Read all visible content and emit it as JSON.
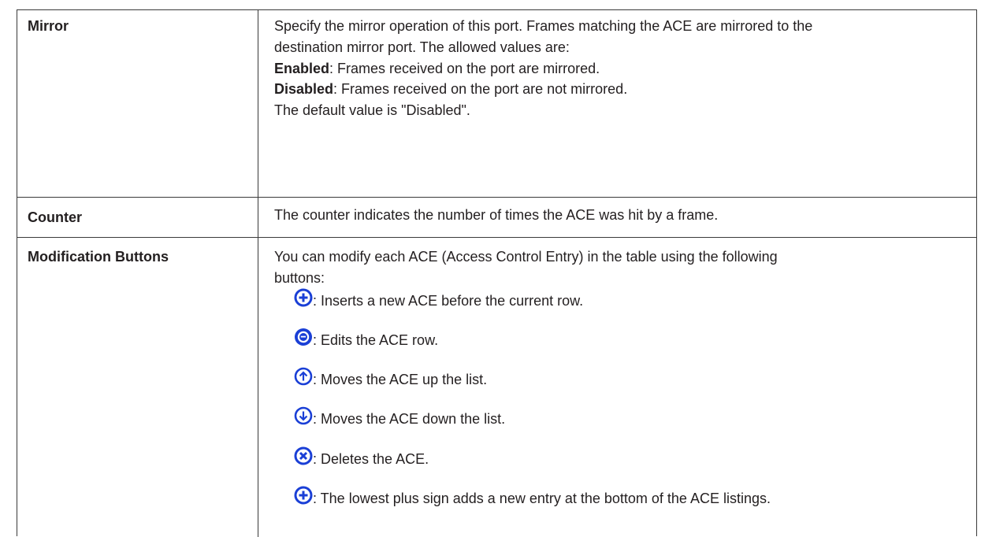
{
  "rows": {
    "mirror": {
      "term": "Mirror",
      "desc_line1": "Specify the mirror operation of this port. Frames matching the ACE are mirrored to the",
      "desc_line2": "destination mirror port. The allowed values are:",
      "enabled_label": "Enabled",
      "enabled_text": ": Frames received on the port are mirrored.",
      "disabled_label": "Disabled",
      "disabled_text": ": Frames received on the port are not mirrored.",
      "default_text": "The default value is \"Disabled\"."
    },
    "counter": {
      "term": "Counter",
      "desc": "The counter indicates the number of times the ACE was hit by a frame."
    },
    "modification": {
      "term": "Modification Buttons",
      "desc_line1": "You can modify each ACE (Access Control Entry) in the table using the following",
      "desc_line2": "buttons:",
      "buttons": [
        {
          "icon": "plus-circle-icon",
          "text": ": Inserts a new ACE before the current row."
        },
        {
          "icon": "edit-circle-icon",
          "text": ": Edits the ACE row."
        },
        {
          "icon": "up-arrow-circle-icon",
          "text": ": Moves the ACE up the list."
        },
        {
          "icon": "down-arrow-circle-icon",
          "text": ": Moves the ACE down the list."
        },
        {
          "icon": "delete-circle-icon",
          "text": ": Deletes the ACE."
        },
        {
          "icon": "plus-circle-icon",
          "text": ": The lowest plus sign adds a new entry at the bottom of the ACE listings."
        }
      ]
    }
  },
  "colors": {
    "icon_blue": "#1a3fd6",
    "text": "#231f20",
    "border": "#3a3a3a"
  }
}
